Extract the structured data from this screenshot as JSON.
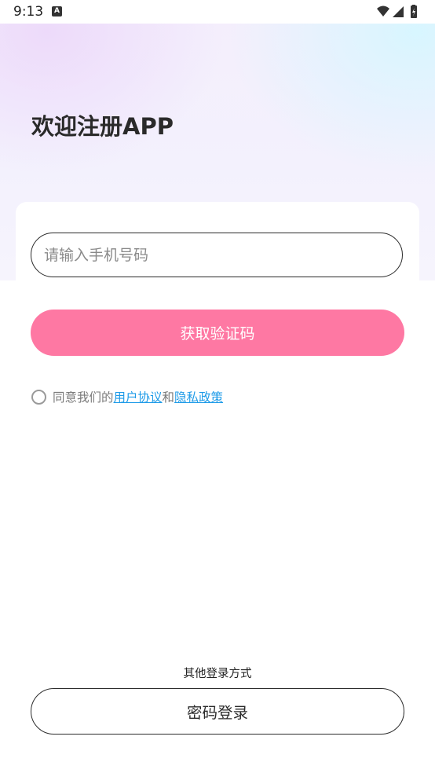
{
  "status_bar": {
    "time": "9:13",
    "notification_icon_letter": "A",
    "icons": [
      "wifi-icon",
      "signal-icon",
      "battery-charging-icon"
    ]
  },
  "header": {
    "title": "欢迎注册APP"
  },
  "form": {
    "phone_placeholder": "请输入手机号码",
    "phone_value": "",
    "get_code_label": "获取验证码",
    "button_color": "#fe78a3"
  },
  "agreement": {
    "checked": false,
    "prefix": "同意我们的",
    "user_agreement": "用户协议",
    "conjunction": "和",
    "privacy_policy": "隐私政策",
    "link_color": "#1e9be8"
  },
  "other_login": {
    "label": "其他登录方式",
    "password_login_label": "密码登录"
  }
}
